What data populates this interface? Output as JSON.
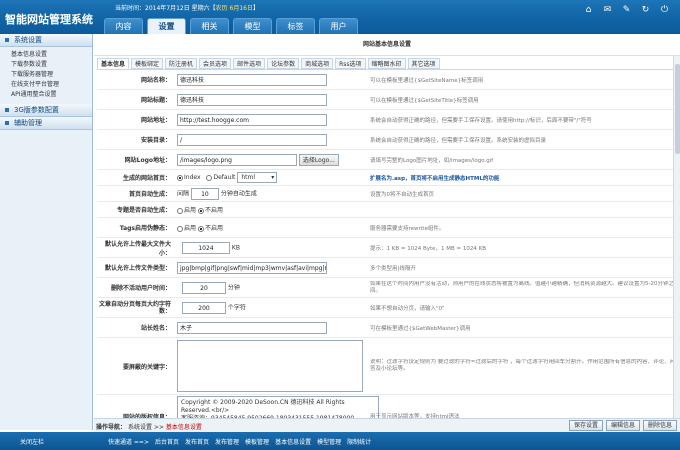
{
  "app_title": "智能网站管理系统",
  "topbar": {
    "time_prefix": "当前时间：2014年7月12日 星期六【",
    "time_lunar": "农历 6月16日",
    "time_suffix": "】"
  },
  "nav": [
    "内容",
    "设置",
    "相关",
    "模型",
    "标签",
    "用户"
  ],
  "top_icons": [
    "home-icon",
    "mail-icon",
    "tools-icon",
    "refresh-icon",
    "power-icon"
  ],
  "sidebar": {
    "sections": [
      {
        "title": "系统设置",
        "items": [
          "基本信息设置",
          "下载参数设置",
          "下载服务器管理",
          "在线支付平台管理",
          "API通用整合设置"
        ]
      },
      {
        "title": "3G版参数配置",
        "items": []
      },
      {
        "title": "辅助管理",
        "items": []
      }
    ]
  },
  "page_title": "网站基本信息设置",
  "subtabs": [
    "基本信息",
    "模板绑定",
    "防注册机",
    "会员选项",
    "邮件选项",
    "论坛参数",
    "商城选项",
    "Rss选项",
    "缩略图水印",
    "其它选项"
  ],
  "form": {
    "site_name": {
      "label": "网站名称：",
      "value": "德迅科技",
      "note": "可以在模板里通过{$GetSiteName}标签调用"
    },
    "site_title": {
      "label": "网站标题：",
      "value": "德迅科技",
      "note": "可以在模板里通过{$GetSiteTitle}标签调用"
    },
    "site_url": {
      "label": "网站地址：",
      "value": "http://test.hoogge.com",
      "note": "系统会自动获得正确的路径，但需要手工保存设置。请使用http://标识，后面不要带\"/\"符号"
    },
    "install_dir": {
      "label": "安装目录：",
      "value": "/",
      "note": "系统会自动获得正确的路径，但需要手工保存设置。系统安装的虚拟目录"
    },
    "logo": {
      "label": "网站Logo地址：",
      "value": "/images/logo.png",
      "button": "选择Logo...",
      "note": "请填写完整的Logo图片地址，如/images/logo.gif"
    },
    "home_ext": {
      "label": "生成的网站首页：",
      "opt1": "Index",
      "opt2": "Default",
      "ext": "html",
      "note": "扩展名为.asp，首页将不启用生成静态HTML的功能"
    },
    "auto_gen": {
      "label": "首页自动生成：",
      "prefix": "间隔",
      "value": "10",
      "suffix": "分钟自动生成",
      "note": "设置为0将不自动生成首页"
    },
    "topic_gen": {
      "label": "专题是否自动生成：",
      "opt1": "启用",
      "opt2": "不启用"
    },
    "tags_static": {
      "label": "Tags启用伪静态：",
      "opt1": "启用",
      "opt2": "不启用",
      "note": "服务器需要支持rewrite组件。"
    },
    "max_upload": {
      "label": "默认允许上传最大文件大小：",
      "value": "1024",
      "unit": "KB",
      "note": "提示：1 KB = 1024 Byte，1 MB = 1024 KB"
    },
    "upload_types": {
      "label": "默认允许上传文件类型：",
      "value": "jpg|bmp|gif|png|swf|mid|mp3|wmv|asf|avi|mpg|ram",
      "note": "多个类型用|线隔开"
    },
    "delete_inactive": {
      "label": "删除不活动用户时间：",
      "value": "20",
      "unit": "分钟",
      "note": "如果在这个时间内用户没有活动，则用户的在线状态将被置为离线。值越小越精确，但消耗资源越大。建议设置为5-20分钟之间。"
    },
    "summary_len": {
      "label": "文章自动分页每页大约字符数：",
      "value": "200",
      "unit": "个字符",
      "note": "如果不想自动分页，请输入\"0\""
    },
    "webmaster": {
      "label": "站长姓名：",
      "value": "木子",
      "note": "可在模板里通过{$GetWebMaster}调用"
    },
    "banned_words": {
      "label": "要屏蔽的关键字：",
      "value": "",
      "note": "说明：过滤字符设定规则为 要过滤的字符=过滤后的字符 ，每个过滤字符用回车分割开。作用范围所有信息的内容、评论、问答及小论坛等。"
    },
    "copyright": {
      "label": "网站的版权信息：",
      "value": "Copyright © 2009-2020 DeSoon.CN 德迅科技 All Rights Reserved.<br/>\n客服咨询：934545845 9502669 1803431555 1981478000\n邮箱：muzi@desoon.net\n<br />",
      "note": "用于显示网站版本等，支持html语法"
    }
  },
  "opbar": {
    "label": "操作导航：",
    "crumb1": "系统设置",
    "sep": ">>",
    "crumb2": "基本信息设置",
    "buttons": [
      "保存设置",
      "编辑信息",
      "删除信息"
    ]
  },
  "footer": {
    "left": "关闭左栏",
    "quick_label": "快速通道 ==>",
    "links": [
      "后台首页",
      "发布首页",
      "发布管理",
      "模板管理",
      "基本信息设置",
      "模型管理",
      "限制统计"
    ]
  }
}
